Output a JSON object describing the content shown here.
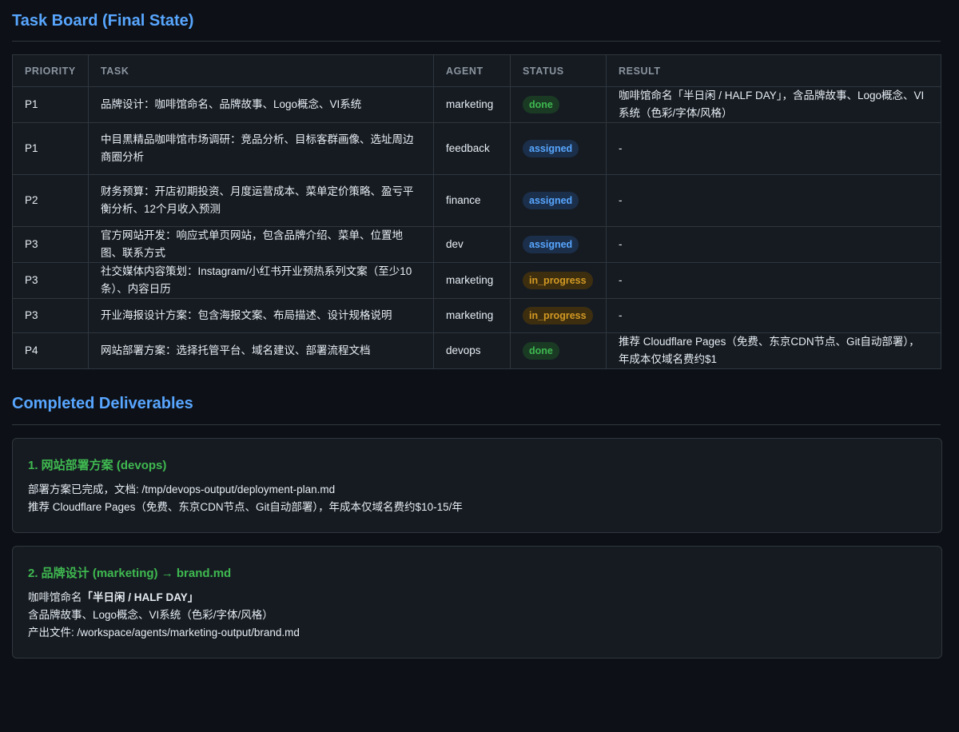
{
  "task_board": {
    "title": "Task Board (Final State)",
    "columns": [
      "PRIORITY",
      "TASK",
      "AGENT",
      "STATUS",
      "RESULT"
    ],
    "rows": [
      {
        "priority": "P1",
        "task": "品牌设计：咖啡馆命名、品牌故事、Logo概念、VI系统",
        "agent": "marketing",
        "status": "done",
        "result": "咖啡馆命名「半日闲 / HALF DAY」，含品牌故事、Logo概念、VI系统（色彩/字体/风格）"
      },
      {
        "priority": "P1",
        "task": "中目黑精品咖啡馆市场调研：竞品分析、目标客群画像、选址周边商圈分析",
        "agent": "feedback",
        "status": "assigned",
        "result": "-"
      },
      {
        "priority": "P2",
        "task": "财务预算：开店初期投资、月度运营成本、菜单定价策略、盈亏平衡分析、12个月收入预测",
        "agent": "finance",
        "status": "assigned",
        "result": "-"
      },
      {
        "priority": "P3",
        "task": "官方网站开发：响应式单页网站，包含品牌介绍、菜单、位置地图、联系方式",
        "agent": "dev",
        "status": "assigned",
        "result": "-"
      },
      {
        "priority": "P3",
        "task": "社交媒体内容策划：Instagram/小红书开业预热系列文案（至少10条）、内容日历",
        "agent": "marketing",
        "status": "in_progress",
        "result": "-"
      },
      {
        "priority": "P3",
        "task": "开业海报设计方案：包含海报文案、布局描述、设计规格说明",
        "agent": "marketing",
        "status": "in_progress",
        "result": "-"
      },
      {
        "priority": "P4",
        "task": "网站部署方案：选择托管平台、域名建议、部署流程文档",
        "agent": "devops",
        "status": "done",
        "result": "推荐 Cloudflare Pages（免费、东京CDN节点、Git自动部署），年成本仅域名费约$1"
      }
    ]
  },
  "deliverables": {
    "title": "Completed Deliverables",
    "items": [
      {
        "heading": "1. 网站部署方案 (devops)",
        "lines": [
          "部署方案已完成，文档: /tmp/devops-output/deployment-plan.md",
          "推荐 Cloudflare Pages（免费、东京CDN节点、Git自动部署），年成本仅域名费约$10-15/年"
        ]
      },
      {
        "heading": "2. 品牌设计 (marketing) → brand.md",
        "name_prefix": "咖啡馆命名",
        "name_value": "「半日闲 / HALF DAY」",
        "lines": [
          "含品牌故事、Logo概念、VI系统（色彩/字体/风格）",
          "产出文件: /workspace/agents/marketing-output/brand.md"
        ]
      }
    ]
  },
  "colors": {
    "background": "#0d1117",
    "heading": "#58a6ff",
    "done": "#3fb950",
    "assigned": "#58a6ff",
    "in_progress": "#d29922"
  }
}
